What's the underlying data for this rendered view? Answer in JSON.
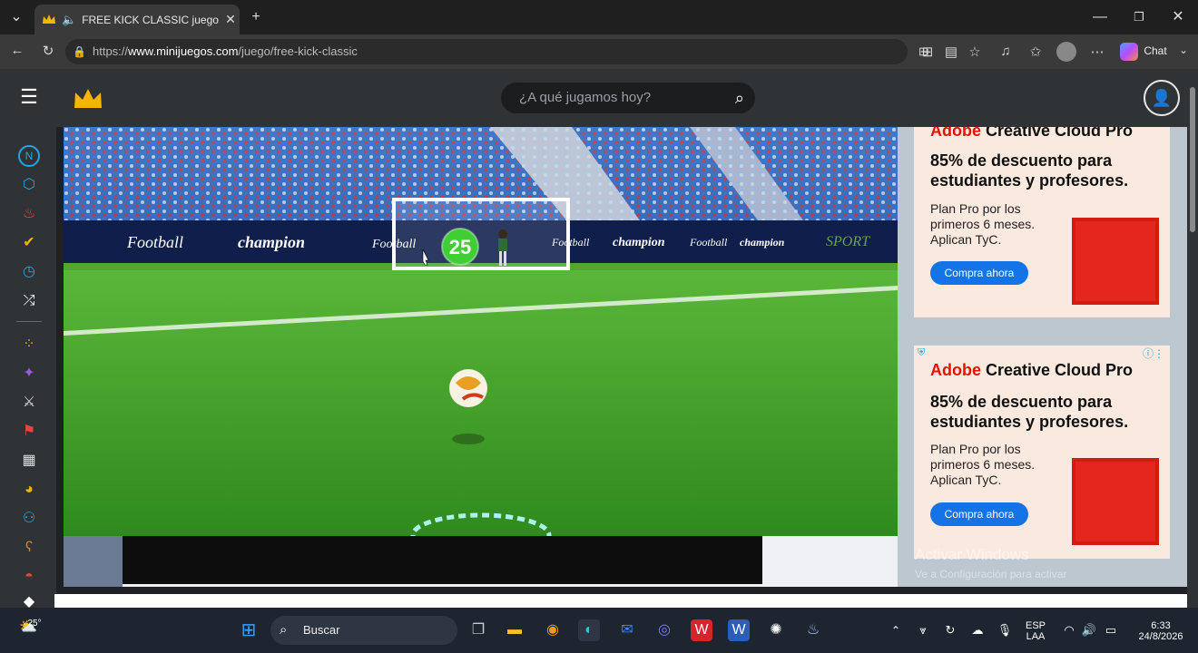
{
  "browser": {
    "tab_title": "FREE KICK CLASSIC juego gra",
    "url_prefix": "https://",
    "url_domain": "www.minijuegos.com",
    "url_path": "/juego/free-kick-classic",
    "chat_label": "Chat"
  },
  "site": {
    "search_placeholder": "¿A qué jugamos hoy?"
  },
  "game": {
    "timer_value": "25",
    "banner_football": "Football",
    "banner_champion": "champion",
    "banner_sport": "SPORT"
  },
  "ads": [
    {
      "brand_prefix": "Adobe",
      "brand_rest": " Creative Cloud Pro",
      "headline": "85% de descuento para estudiantes y profesores.",
      "body": "Plan Pro por los primeros 6 meses. Aplican TyC.",
      "cta": "Compra ahora"
    },
    {
      "brand_prefix": "Adobe",
      "brand_rest": " Creative Cloud Pro",
      "headline": "85% de descuento para estudiantes y profesores.",
      "body": "Plan Pro por los primeros 6 meses. Aplican TyC.",
      "cta": "Compra ahora"
    }
  ],
  "watermark": {
    "line1": "Activar Windows",
    "line2": "Ve a Configuración para activar"
  },
  "taskbar": {
    "weather_temp": "25°",
    "search_label": "Buscar",
    "lang_top": "ESP",
    "lang_bottom": "LAA",
    "time": "6:33",
    "date": "24/8/2026"
  },
  "colors": {
    "pitch": "#3f9d27",
    "accent_blue": "#1473e6",
    "adobe_red": "#eb1000"
  }
}
